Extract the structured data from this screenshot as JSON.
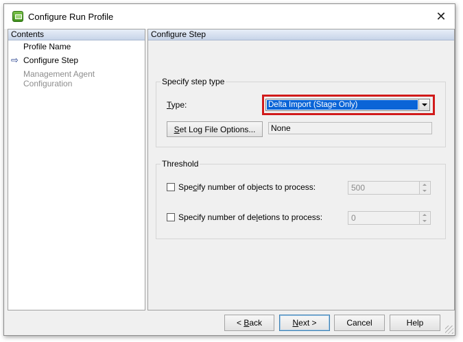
{
  "window": {
    "title": "Configure Run Profile",
    "close_glyph": "✕"
  },
  "left_panel": {
    "header": "Contents",
    "items": [
      {
        "label": "Profile Name",
        "state": "completed"
      },
      {
        "label": "Configure Step",
        "state": "current"
      },
      {
        "label": "Management Agent Configuration",
        "state": "disabled"
      }
    ],
    "current_marker": "⇨"
  },
  "right_panel": {
    "header": "Configure Step",
    "step_type_group": {
      "legend": "Specify step type",
      "type_label_access": "T",
      "type_label_rest": "ype:",
      "type_value": "Delta Import (Stage Only)",
      "log_button_access": "S",
      "log_button_rest": "et Log File Options...",
      "log_value": "None"
    },
    "threshold_group": {
      "legend": "Threshold",
      "objects_label_pre": "Spe",
      "objects_label_access": "c",
      "objects_label_post": "ify number of objects to process:",
      "objects_value": "500",
      "objects_checked": false,
      "deletions_label_pre": "Specify number of de",
      "deletions_label_access": "l",
      "deletions_label_post": "etions to process:",
      "deletions_value": "0",
      "deletions_checked": false
    }
  },
  "footer": {
    "back_arrow": "< ",
    "back_access": "B",
    "back_rest": "ack",
    "next_access": "N",
    "next_rest": "ext",
    "next_arrow": " >",
    "cancel": "Cancel",
    "help": "Help"
  },
  "colors": {
    "highlight_border": "#d11a1a",
    "selection": "#0a64d7"
  }
}
